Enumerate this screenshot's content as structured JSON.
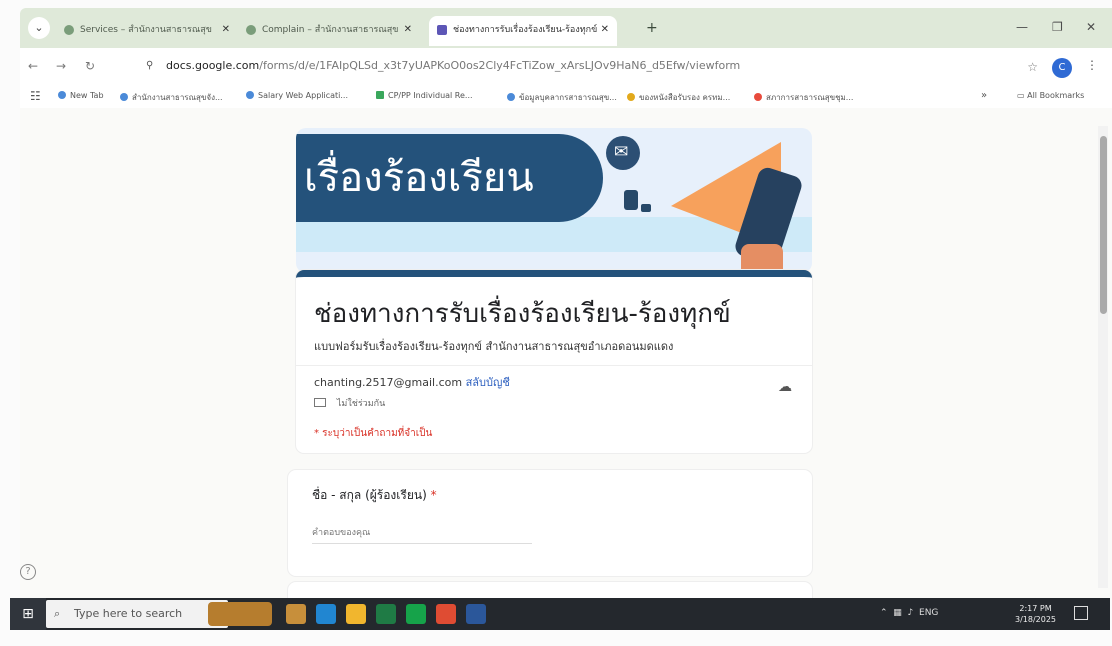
{
  "tabs": [
    {
      "label": "Services – สำนักงานสาธารณสุข"
    },
    {
      "label": "Complain – สำนักงานสาธารณสุข"
    },
    {
      "label": "ช่องทางการรับเรื่องร้องเรียน-ร้องทุกข์"
    }
  ],
  "address": {
    "host": "docs.google.com",
    "path": "/forms/d/e/1FAIpQLSd_x3t7yUAPKoO0os2Cly4FcTiZow_xArsLJOv9HaN6_d5Efw/viewform"
  },
  "profile": {
    "initial": "C"
  },
  "bookmarks": [
    "New Tab",
    "สำนักงานสาธารณสุขจัง...",
    "Salary Web Applicati...",
    "CP/PP Individual Re...",
    "ข้อมูลบุคลากรสาธารณสุข...",
    "ของหนังสือรับรอง ครทม...",
    "สภาการสาธารณสุขชุม..."
  ],
  "bookmarks_all": "All Bookmarks",
  "banner": {
    "title": "เรื่องร้องเรียน"
  },
  "form": {
    "title": "ช่องทางการรับเรื่องร้องเรียน-ร้องทุกข์",
    "description": "แบบฟอร์มรับเรื่องร้องเรียน-ร้องทุกข์ สำนักงานสาธารณสุขอำเภอดอนมดแดง",
    "required_note": "* ระบุว่าเป็นคำถามที่จำเป็น"
  },
  "account": {
    "email": "chanting.2517@gmail.com",
    "switch_label": "สลับบัญชี",
    "not_shared": "ไม่ใช่ร่วมกัน"
  },
  "question": {
    "label": "ชื่อ - สกุล (ผู้ร้องเรียน)",
    "required_mark": "*",
    "placeholder": "คำตอบของคุณ"
  },
  "taskbar": {
    "search_placeholder": "Type here to search",
    "language": "ENG",
    "time": "2:17 PM",
    "date": "3/18/2025"
  }
}
